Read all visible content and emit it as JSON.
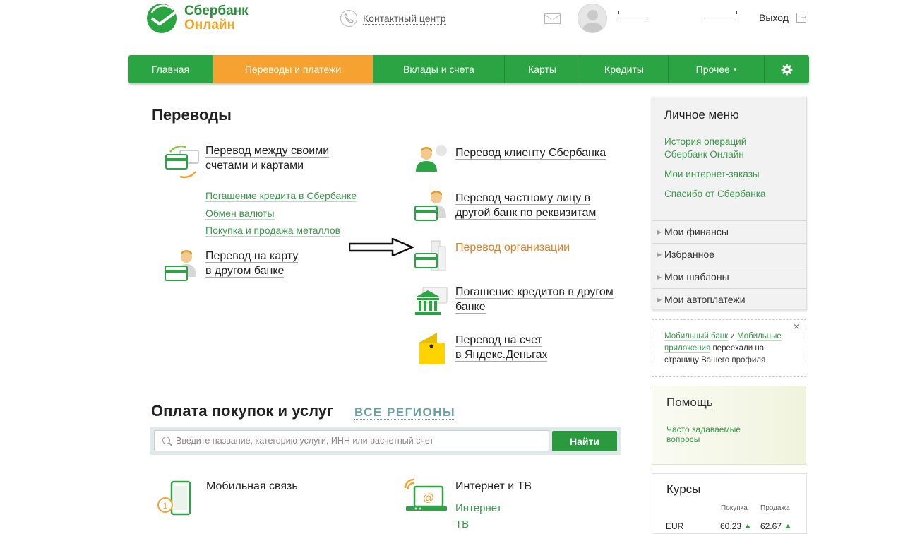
{
  "header": {
    "logo_line1": "Сбербанк",
    "logo_line2": "Онлайн",
    "contact_center": "Контактный центр",
    "logout": "Выход"
  },
  "nav": {
    "items": [
      "Главная",
      "Переводы и платежи",
      "Вклады и счета",
      "Карты",
      "Кредиты",
      "Прочее"
    ],
    "more_caret": "▾",
    "settings_icon": "gear-icon",
    "active_index": 1,
    "colors": {
      "bar": "#2ba443",
      "active": "#f6a231"
    }
  },
  "transfers": {
    "heading": "Переводы",
    "own_accounts": [
      "Перевод между своими",
      "счетами и картами"
    ],
    "sublinks": [
      "Погашение кредита в Сбербанке",
      "Обмен валюты",
      "Покупка и продажа металлов"
    ],
    "card_other_bank": [
      "Перевод на карту",
      "в другом банке"
    ],
    "sber_client": "Перевод клиенту Сбербанка",
    "private_person": [
      "Перевод частному лицу в",
      "другой банк по реквизитам"
    ],
    "organization": "Перевод организации",
    "loans_other_bank": [
      "Погашение кредитов в другом",
      "банке"
    ],
    "yandex": [
      "Перевод на счет",
      "в Яндекс.Деньгах"
    ]
  },
  "payments": {
    "heading": "Оплата покупок и услуг",
    "all_regions": "ВСЕ РЕГИОНЫ",
    "search_placeholder": "Введите название, категорию услуги, ИНН или расчетный счет",
    "search_button": "Найти",
    "mobile": "Мобильная связь",
    "internet_tv": "Интернет и ТВ",
    "internet_tv_links": [
      "Интернет",
      "ТВ"
    ]
  },
  "personal_menu": {
    "title": "Личное меню",
    "links": [
      [
        "История операций",
        "Сбербанк Онлайн"
      ],
      [
        "Мои интернет-заказы"
      ],
      [
        "Спасибо от Сбербанка"
      ]
    ],
    "rows": [
      "Мои финансы",
      "Избранное",
      "Мои шаблоны",
      "Мои автоплатежи"
    ]
  },
  "notice": {
    "link1": "Мобильный банк",
    "and": " и ",
    "link2a": "Мобильные",
    "link2b": "приложения",
    "text_a": " переехали на",
    "text_b": "страницу Вашего профиля",
    "close": "×"
  },
  "help": {
    "title": "Помощь",
    "faq": [
      "Часто задаваемые",
      "вопросы"
    ]
  },
  "rates": {
    "title": "Курсы",
    "col_buy": "Покупка",
    "col_sell": "Продажа",
    "rows": [
      {
        "currency": "EUR",
        "buy": "60.23",
        "sell": "62.67"
      }
    ]
  }
}
